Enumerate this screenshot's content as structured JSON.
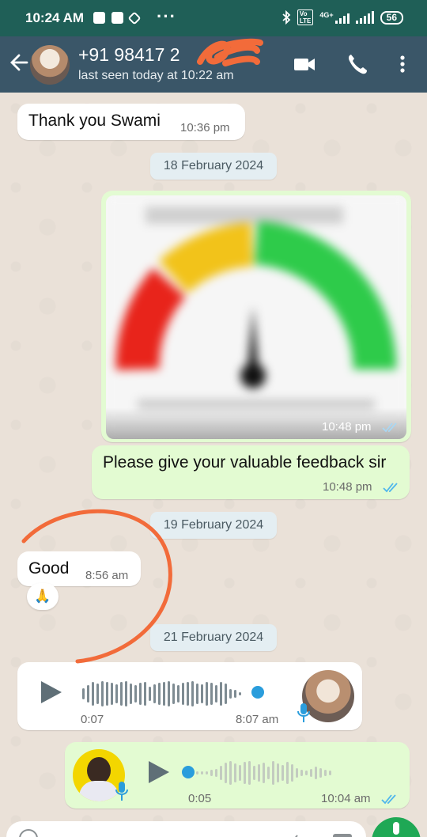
{
  "status_bar": {
    "time": "10:24 AM",
    "network": "4G+",
    "battery": "56",
    "icons": [
      "message-icon",
      "message-icon",
      "dropbox-icon",
      "more-dots-icon",
      "bluetooth-icon",
      "volte-icon",
      "signal-icon",
      "wifi-icon",
      "battery-icon"
    ]
  },
  "header": {
    "contact_name": "+91 98417 2",
    "last_seen": "last seen today at 10:22 am",
    "icons": [
      "back-arrow-icon",
      "avatar",
      "video-call-icon",
      "phone-icon",
      "more-vert-icon"
    ],
    "bg_color": "#3a5668"
  },
  "messages": {
    "m1": {
      "text": "Thank you Swami",
      "time": "10:36 pm"
    },
    "date1": "18 February 2024",
    "m2": {
      "time": "10:48 pm"
    },
    "m3": {
      "text": "Please give your valuable feedback sir",
      "time": "10:48 pm"
    },
    "date2": "19 February 2024",
    "m4": {
      "text": "Good",
      "time": "8:56 am",
      "reaction": "🙏"
    },
    "date3": "21 February 2024",
    "m5": {
      "duration": "0:07",
      "time": "8:07 am",
      "progress": 1.0
    },
    "m6": {
      "duration": "0:05",
      "time": "10:04 am",
      "progress": 0.0
    }
  },
  "colors": {
    "incoming": "#ffffff",
    "outgoing": "#e3fbd2",
    "read_ticks": "#4fb6ec",
    "annotation": "#f26b3a",
    "accent": "#1fa855"
  }
}
